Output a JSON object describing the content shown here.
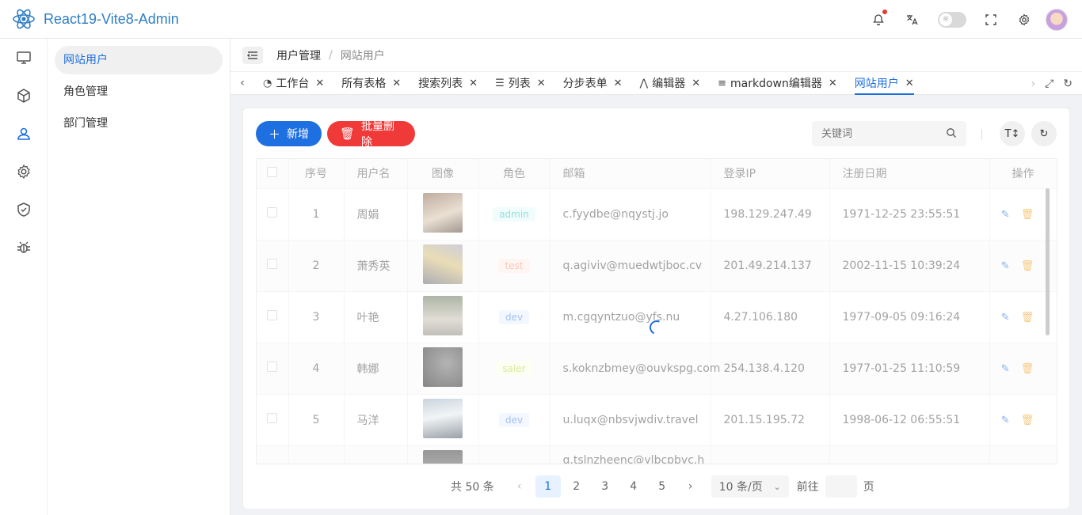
{
  "app": {
    "title": "React19-Vite8-Admin"
  },
  "colors": {
    "primary": "#1e6fe0",
    "danger": "#f03a3a",
    "logo": "#2f7ec4"
  },
  "header": {
    "icons": [
      "bell-icon",
      "translate-icon",
      "theme-toggle",
      "fullscreen-icon",
      "settings-icon",
      "avatar"
    ]
  },
  "rail": {
    "icons": [
      "monitor-icon",
      "cube-icon",
      "user-icon",
      "gear-icon",
      "shield-icon",
      "bug-icon"
    ]
  },
  "submenu": {
    "items": [
      {
        "label": "网站用户"
      },
      {
        "label": "角色管理"
      },
      {
        "label": "部门管理"
      }
    ]
  },
  "breadcrumb": {
    "parent": "用户管理",
    "sep": "/",
    "current": "网站用户"
  },
  "tabs": [
    {
      "label": "工作台",
      "icon": "dashboard-icon"
    },
    {
      "label": "所有表格"
    },
    {
      "label": "搜索列表"
    },
    {
      "label": "列表",
      "icon": "list-icon"
    },
    {
      "label": "分步表单"
    },
    {
      "label": "编辑器",
      "icon": "editor-icon"
    },
    {
      "label": "markdown编辑器",
      "icon": "list-icon"
    },
    {
      "label": "网站用户"
    }
  ],
  "toolbar": {
    "add_label": "新增",
    "batch_delete_label": "批量删除",
    "search_placeholder": "关键词"
  },
  "table": {
    "columns": [
      "序号",
      "用户名",
      "图像",
      "角色",
      "邮箱",
      "登录IP",
      "注册日期",
      "操作"
    ],
    "rows": [
      {
        "no": "1",
        "name": "周娟",
        "role": "admin",
        "email": "c.fyydbe@nqystj.jo",
        "ip": "198.129.247.49",
        "date": "1971-12-25 23:55:51"
      },
      {
        "no": "2",
        "name": "萧秀英",
        "role": "test",
        "email": "q.agiviv@muedwtjboc.cv",
        "ip": "201.49.214.137",
        "date": "2002-11-15 10:39:24"
      },
      {
        "no": "3",
        "name": "叶艳",
        "role": "dev",
        "email": "m.cgqyntzuo@yfs.nu",
        "ip": "4.27.106.180",
        "date": "1977-09-05 09:16:24"
      },
      {
        "no": "4",
        "name": "韩娜",
        "role": "saler",
        "email": "s.koknzbmey@ouvkspg.com",
        "ip": "254.138.4.120",
        "date": "1977-01-25 11:10:59"
      },
      {
        "no": "5",
        "name": "马洋",
        "role": "dev",
        "email": "u.luqx@nbsvjwdiv.travel",
        "ip": "201.15.195.72",
        "date": "1998-06-12 06:55:51"
      },
      {
        "no": "",
        "name": "",
        "role": "",
        "email": "q.tslnzheenc@ylbcpbyc.h",
        "ip": "",
        "date": ""
      }
    ]
  },
  "pagination": {
    "total": "共 50 条",
    "pages": [
      "1",
      "2",
      "3",
      "4",
      "5"
    ],
    "current": "1",
    "page_size": "10 条/页",
    "goto_label": "前往",
    "page_suffix": "页"
  }
}
